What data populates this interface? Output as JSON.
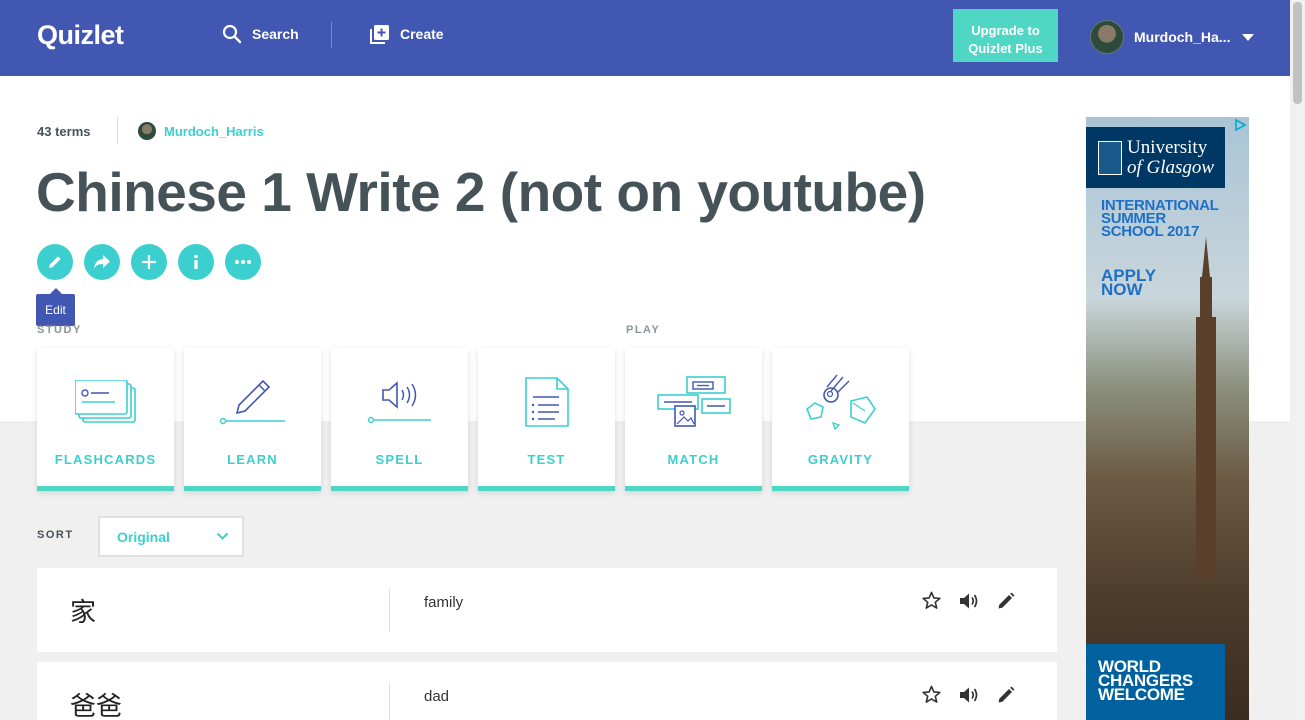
{
  "header": {
    "logo": "Quizlet",
    "search_label": "Search",
    "create_label": "Create",
    "upgrade_line1": "Upgrade to",
    "upgrade_line2": "Quizlet Plus",
    "username": "Murdoch_Ha..."
  },
  "set": {
    "term_count": "43 terms",
    "author": "Murdoch_Harris",
    "title": "Chinese 1 Write 2 (not on youtube)",
    "tooltip": "Edit"
  },
  "sections": {
    "study": "STUDY",
    "play": "PLAY"
  },
  "modes": [
    {
      "label": "FLASHCARDS",
      "icon": "flashcards-icon"
    },
    {
      "label": "LEARN",
      "icon": "learn-icon"
    },
    {
      "label": "SPELL",
      "icon": "spell-icon"
    },
    {
      "label": "TEST",
      "icon": "test-icon"
    },
    {
      "label": "MATCH",
      "icon": "match-icon"
    },
    {
      "label": "GRAVITY",
      "icon": "gravity-icon"
    }
  ],
  "sort": {
    "label": "SORT",
    "selected": "Original"
  },
  "terms": [
    {
      "word": "家",
      "definition": "family"
    },
    {
      "word": "爸爸",
      "definition": "dad"
    }
  ],
  "ad": {
    "logo_line1": "University",
    "logo_line2": "of Glasgow",
    "headline_1": "INTERNATIONAL",
    "headline_2": "SUMMER",
    "headline_3": "SCHOOL 2017",
    "apply_1": "APPLY",
    "apply_2": "NOW",
    "bottom_1": "WORLD",
    "bottom_2": "CHANGERS",
    "bottom_3": "WELCOME"
  },
  "colors": {
    "header": "#4257b2",
    "accent": "#3ccfcf",
    "upgrade": "#4fd6c5",
    "text": "#455358"
  }
}
